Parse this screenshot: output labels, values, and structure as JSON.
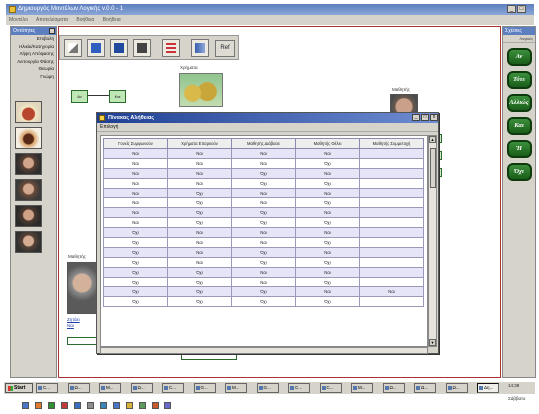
{
  "main_window": {
    "title": "Δημιουργός Μοντέλων Λογικής v.0.0 - 1",
    "menu": [
      "Μοντέλο",
      "Αποτελέσματα",
      "Βοήθεια",
      "Βοήθεια"
    ]
  },
  "left_panel": {
    "title": "Οντότητες",
    "items": [
      "Επιβολή",
      "Ηλικία/Κατηγορία",
      "Λήψη Απόφασης",
      "Λειτουργία Φάσης",
      "Θεωρία",
      "Γνώμη"
    ]
  },
  "right_panel": {
    "title": "Σχέσεις",
    "subtitle": "Λογικές",
    "buttons": [
      "Αν",
      "Τότε",
      "Αλλιώς",
      "Και",
      "Ή",
      "Όχι"
    ]
  },
  "canvas": {
    "toolbar": {
      "ref_label": "Ref"
    },
    "nodes": [
      "Αν",
      "Και"
    ],
    "money_caption": "Χρήματα",
    "right_person_caption": "Μαθητής",
    "left_person_caption": "Μαθητής",
    "left_link_line1": "Ζητάει",
    "left_link_line2": "Ναι"
  },
  "truth_table": {
    "title": "Πίνακας Αλήθειας",
    "menu": "Επιλογή",
    "columns": [
      "Γονείς Συμφωνούν",
      "Χρήματα Επαρκούν",
      "Μαθητής Διάβασε",
      "Μαθητής Θέλει",
      "Μαθητής Συμμετοχή"
    ],
    "rows": [
      [
        "Ναι",
        "Ναι",
        "Ναι",
        "Ναι",
        ""
      ],
      [
        "Ναι",
        "Ναι",
        "Ναι",
        "Όχι",
        ""
      ],
      [
        "Ναι",
        "Ναι",
        "Όχι",
        "Ναι",
        ""
      ],
      [
        "Ναι",
        "Ναι",
        "Όχι",
        "Όχι",
        ""
      ],
      [
        "Ναι",
        "Όχι",
        "Ναι",
        "Ναι",
        ""
      ],
      [
        "Ναι",
        "Όχι",
        "Ναι",
        "Όχι",
        ""
      ],
      [
        "Ναι",
        "Όχι",
        "Όχι",
        "Ναι",
        ""
      ],
      [
        "Ναι",
        "Όχι",
        "Όχι",
        "Όχι",
        ""
      ],
      [
        "Όχι",
        "Ναι",
        "Ναι",
        "Ναι",
        ""
      ],
      [
        "Όχι",
        "Ναι",
        "Ναι",
        "Όχι",
        ""
      ],
      [
        "Όχι",
        "Ναι",
        "Όχι",
        "Ναι",
        ""
      ],
      [
        "Όχι",
        "Ναι",
        "Όχι",
        "Όχι",
        ""
      ],
      [
        "Όχι",
        "Όχι",
        "Ναι",
        "Ναι",
        ""
      ],
      [
        "Όχι",
        "Όχι",
        "Ναι",
        "Όχι",
        ""
      ],
      [
        "Όχι",
        "Όχι",
        "Όχι",
        "Ναι",
        "Ναι"
      ],
      [
        "Όχι",
        "Όχι",
        "Όχι",
        "Όχι",
        ""
      ]
    ]
  },
  "taskbar": {
    "start_label": "Start",
    "tasks": [
      "C...",
      "Ω...",
      "M...",
      "Ω...",
      "C...",
      "G...",
      "M...",
      "G...",
      "C...",
      "C...",
      "M...",
      "Ω...",
      "Ω...",
      "Ω...",
      "Δη..."
    ],
    "clock": "14:39",
    "day": "Σάββατο"
  }
}
